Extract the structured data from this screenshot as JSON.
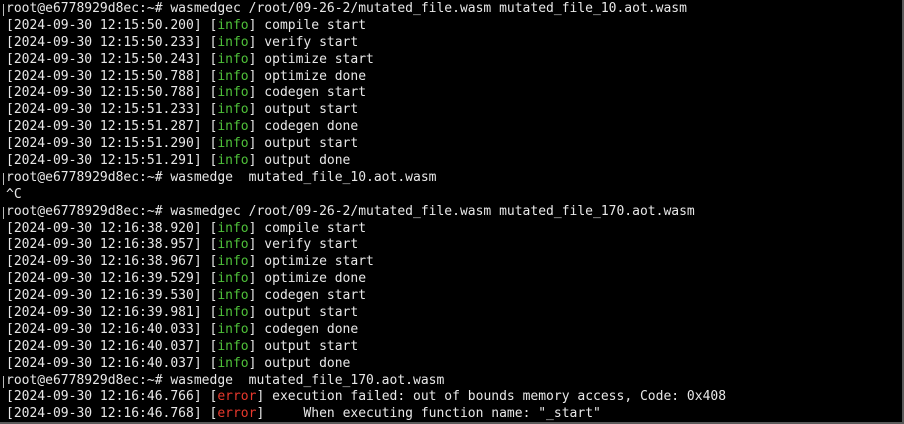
{
  "colors": {
    "background": "#000000",
    "text": "#e8e8e8",
    "info": "#4fc13a",
    "error": "#e8382c"
  },
  "terminal": {
    "lines": [
      {
        "kind": "prompt",
        "text": "root@e6778929d8ec:~# wasmedgec /root/09-26-2/mutated_file.wasm mutated_file_10.aot.wasm"
      },
      {
        "kind": "log",
        "ts": "[2024-09-30 12:15:50.200]",
        "level": "info",
        "msg": " compile start"
      },
      {
        "kind": "log",
        "ts": "[2024-09-30 12:15:50.233]",
        "level": "info",
        "msg": " verify start"
      },
      {
        "kind": "log",
        "ts": "[2024-09-30 12:15:50.243]",
        "level": "info",
        "msg": " optimize start"
      },
      {
        "kind": "log",
        "ts": "[2024-09-30 12:15:50.788]",
        "level": "info",
        "msg": " optimize done"
      },
      {
        "kind": "log",
        "ts": "[2024-09-30 12:15:50.788]",
        "level": "info",
        "msg": " codegen start"
      },
      {
        "kind": "log",
        "ts": "[2024-09-30 12:15:51.233]",
        "level": "info",
        "msg": " output start"
      },
      {
        "kind": "log",
        "ts": "[2024-09-30 12:15:51.287]",
        "level": "info",
        "msg": " codegen done"
      },
      {
        "kind": "log",
        "ts": "[2024-09-30 12:15:51.290]",
        "level": "info",
        "msg": " output start"
      },
      {
        "kind": "log",
        "ts": "[2024-09-30 12:15:51.291]",
        "level": "info",
        "msg": " output done"
      },
      {
        "kind": "prompt",
        "text": "root@e6778929d8ec:~# wasmedge  mutated_file_10.aot.wasm"
      },
      {
        "kind": "plain",
        "text": "^C"
      },
      {
        "kind": "prompt",
        "text": "root@e6778929d8ec:~# wasmedgec /root/09-26-2/mutated_file.wasm mutated_file_170.aot.wasm"
      },
      {
        "kind": "log",
        "ts": "[2024-09-30 12:16:38.920]",
        "level": "info",
        "msg": " compile start"
      },
      {
        "kind": "log",
        "ts": "[2024-09-30 12:16:38.957]",
        "level": "info",
        "msg": " verify start"
      },
      {
        "kind": "log",
        "ts": "[2024-09-30 12:16:38.967]",
        "level": "info",
        "msg": " optimize start"
      },
      {
        "kind": "log",
        "ts": "[2024-09-30 12:16:39.529]",
        "level": "info",
        "msg": " optimize done"
      },
      {
        "kind": "log",
        "ts": "[2024-09-30 12:16:39.530]",
        "level": "info",
        "msg": " codegen start"
      },
      {
        "kind": "log",
        "ts": "[2024-09-30 12:16:39.981]",
        "level": "info",
        "msg": " output start"
      },
      {
        "kind": "log",
        "ts": "[2024-09-30 12:16:40.033]",
        "level": "info",
        "msg": " codegen done"
      },
      {
        "kind": "log",
        "ts": "[2024-09-30 12:16:40.037]",
        "level": "info",
        "msg": " output start"
      },
      {
        "kind": "log",
        "ts": "[2024-09-30 12:16:40.037]",
        "level": "info",
        "msg": " output done"
      },
      {
        "kind": "prompt",
        "text": "root@e6778929d8ec:~# wasmedge  mutated_file_170.aot.wasm"
      },
      {
        "kind": "log",
        "ts": "[2024-09-30 12:16:46.766]",
        "level": "error",
        "msg": " execution failed: out of bounds memory access, Code: 0x408"
      },
      {
        "kind": "log",
        "ts": "[2024-09-30 12:16:46.768]",
        "level": "error",
        "msg": "     When executing function name: \"_start\""
      }
    ]
  }
}
